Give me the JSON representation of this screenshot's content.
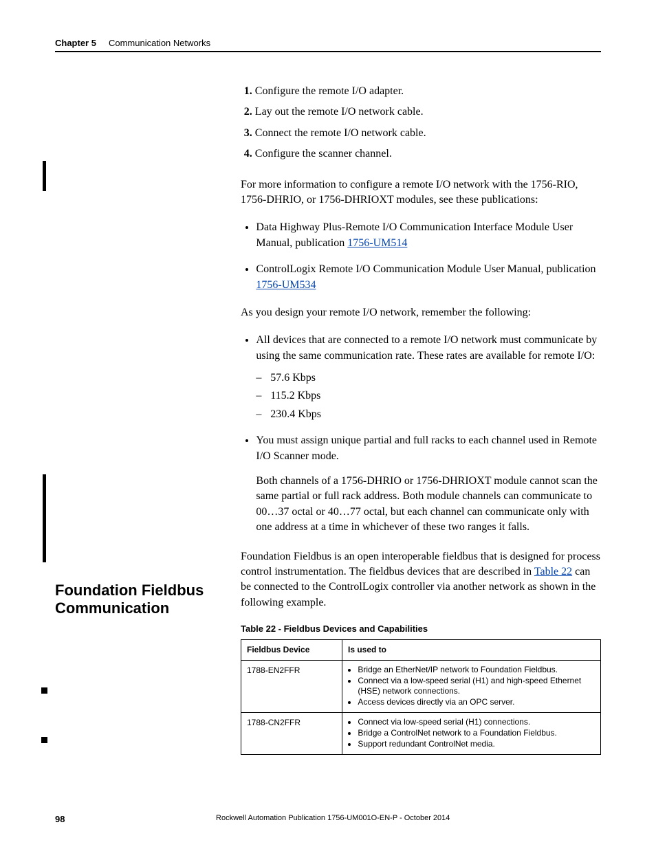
{
  "header": {
    "chapter": "Chapter 5",
    "name": "Communication Networks"
  },
  "steps": {
    "s1": "Configure the remote I/O adapter.",
    "s2": "Lay out the remote I/O network cable.",
    "s3": "Connect the remote I/O network cable.",
    "s4": "Configure the scanner channel."
  },
  "para1": "For more information to configure a remote I/O network with the 1756-RIO, 1756-DHRIO, or 1756-DHRIOXT modules, see these publications:",
  "pub_bullets": {
    "b1_pre": "Data Highway Plus-Remote I/O Communication Interface Module User Manual, publication ",
    "b1_link": "1756-UM514",
    "b2_pre": "ControlLogix Remote I/O Communication Module User Manual, publication ",
    "b2_link": "1756-UM534"
  },
  "para2": "As you design your remote I/O network, remember the following:",
  "design_bullets": {
    "b1": "All devices that are connected to a remote I/O network must communicate by using the same communication rate. These rates are available for remote I/O:",
    "rates": {
      "r1": "57.6 Kbps",
      "r2": "115.2 Kbps",
      "r3": "230.4 Kbps"
    },
    "b2": "You must assign unique partial and full racks to each channel used in Remote I/O Scanner mode.",
    "b2_para": "Both channels of a 1756-DHRIO or 1756-DHRIOXT module cannot scan the same partial or full rack address. Both module channels can communicate to 00…37 octal or 40…77 octal, but each channel can communicate only with one address at a time in whichever of these two ranges it falls."
  },
  "section": {
    "title": "Foundation Fieldbus Communication",
    "para_pre": "Foundation Fieldbus is an open interoperable fieldbus that is designed for process control instrumentation. The fieldbus devices that are described in ",
    "para_link": "Table 22",
    "para_post": " can be connected to the ControlLogix controller via another network as shown in the following example."
  },
  "table": {
    "caption": "Table 22 - Fieldbus Devices and Capabilities",
    "col1": "Fieldbus Device",
    "col2": "Is used to",
    "rows": {
      "r1": {
        "device": "1788-EN2FFR",
        "b1": "Bridge an EtherNet/IP network to Foundation Fieldbus.",
        "b2": "Connect via a low-speed serial (H1) and high-speed Ethernet (HSE) network connections.",
        "b3": "Access devices directly via an OPC server."
      },
      "r2": {
        "device": "1788-CN2FFR",
        "b1": "Connect via low-speed serial (H1) connections.",
        "b2": "Bridge a ControlNet network to a Foundation Fieldbus.",
        "b3": "Support redundant ControlNet media."
      }
    }
  },
  "footer": {
    "page": "98",
    "pub": "Rockwell Automation Publication 1756-UM001O-EN-P - October 2014"
  }
}
